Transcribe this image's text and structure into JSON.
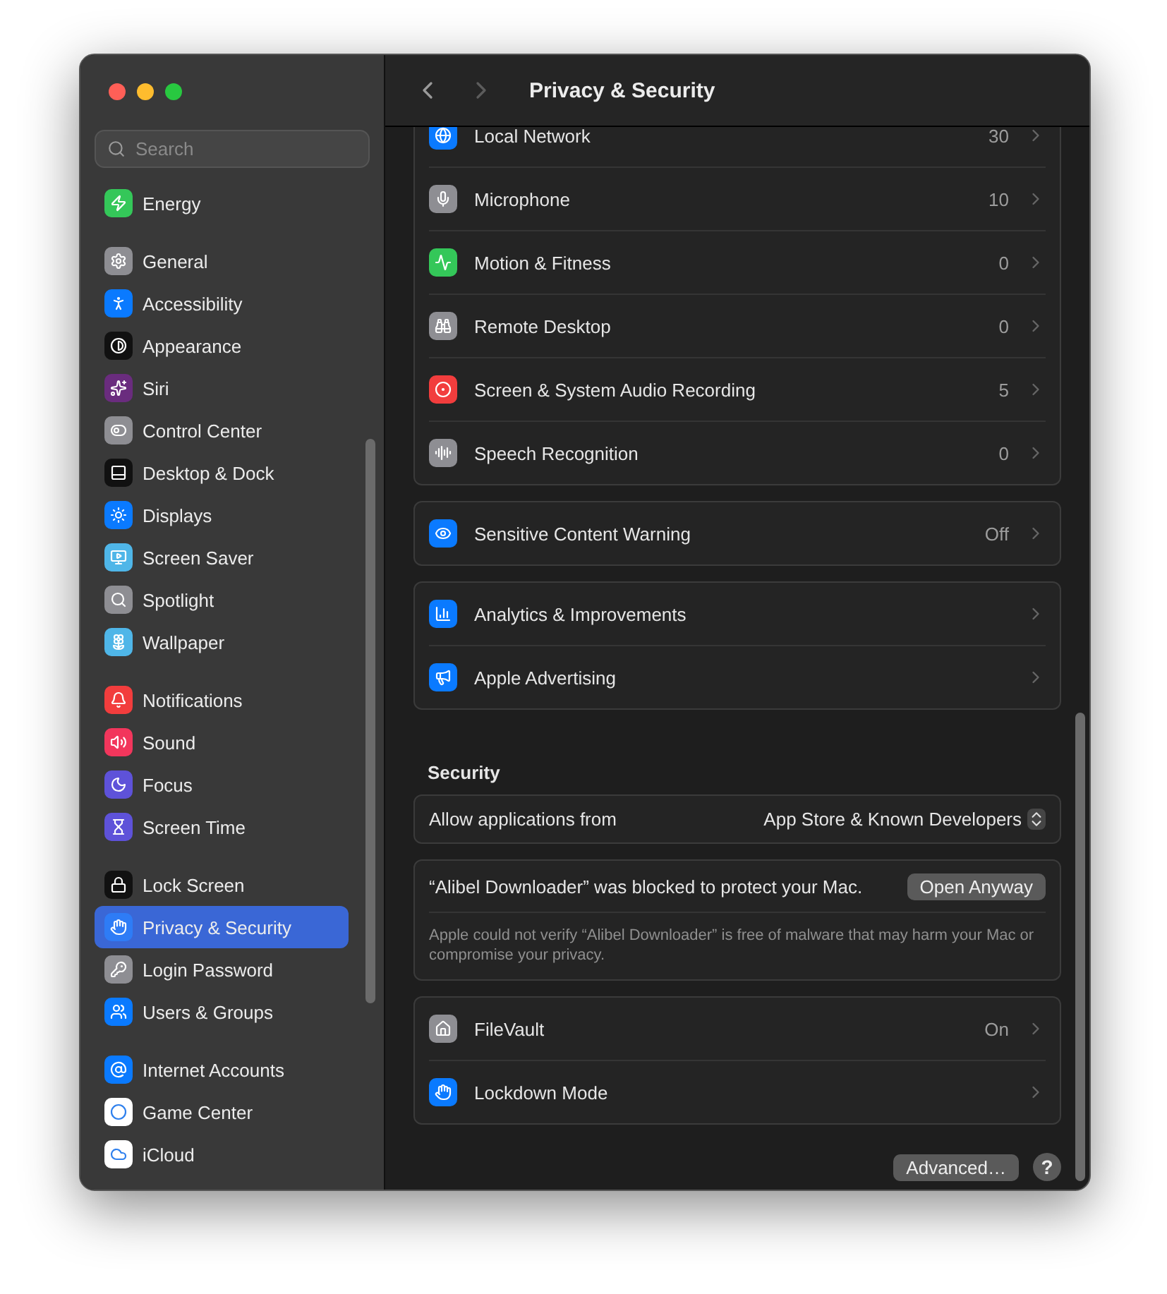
{
  "window": {
    "title": "Privacy & Security"
  },
  "sidebar": {
    "search": {
      "placeholder": "Search"
    },
    "groups": [
      {
        "items": [
          {
            "label": "Energy",
            "selected": false,
            "color": "#34c759"
          }
        ]
      },
      {
        "items": [
          {
            "label": "General",
            "selected": false,
            "color": "#8e8e93"
          },
          {
            "label": "Accessibility",
            "selected": false,
            "color": "#0a7aff"
          },
          {
            "label": "Appearance",
            "selected": false,
            "color": "#111111"
          },
          {
            "label": "Siri",
            "selected": false,
            "color": "#6a2c7e"
          },
          {
            "label": "Control Center",
            "selected": false,
            "color": "#8e8e93"
          },
          {
            "label": "Desktop & Dock",
            "selected": false,
            "color": "#111111"
          },
          {
            "label": "Displays",
            "selected": false,
            "color": "#0a7aff"
          },
          {
            "label": "Screen Saver",
            "selected": false,
            "color": "#4fb6e8"
          },
          {
            "label": "Spotlight",
            "selected": false,
            "color": "#8e8e93"
          },
          {
            "label": "Wallpaper",
            "selected": false,
            "color": "#4fb6e8"
          }
        ]
      },
      {
        "items": [
          {
            "label": "Notifications",
            "selected": false,
            "color": "#f23d3d"
          },
          {
            "label": "Sound",
            "selected": false,
            "color": "#f2365c"
          },
          {
            "label": "Focus",
            "selected": false,
            "color": "#5e52d9"
          },
          {
            "label": "Screen Time",
            "selected": false,
            "color": "#5e52d9"
          }
        ]
      },
      {
        "items": [
          {
            "label": "Lock Screen",
            "selected": false,
            "color": "#111111"
          },
          {
            "label": "Privacy & Security",
            "selected": true,
            "color": "#2e7cf6"
          },
          {
            "label": "Login Password",
            "selected": false,
            "color": "#8e8e93"
          },
          {
            "label": "Users & Groups",
            "selected": false,
            "color": "#0a7aff"
          }
        ]
      },
      {
        "items": [
          {
            "label": "Internet Accounts",
            "selected": false,
            "color": "#0a7aff"
          },
          {
            "label": "Game Center",
            "selected": false,
            "color": "#ffffff"
          },
          {
            "label": "iCloud",
            "selected": false,
            "color": "#ffffff"
          }
        ]
      }
    ]
  },
  "cards": [
    {
      "rows": [
        {
          "label": "Local Network",
          "value": "30",
          "color": "#0a7aff"
        },
        {
          "label": "Microphone",
          "value": "10",
          "color": "#8e8e93"
        },
        {
          "label": "Motion & Fitness",
          "value": "0",
          "color": "#34c759"
        },
        {
          "label": "Remote Desktop",
          "value": "0",
          "color": "#8e8e93"
        },
        {
          "label": "Screen & System Audio Recording",
          "value": "5",
          "color": "#f23d3d"
        },
        {
          "label": "Speech Recognition",
          "value": "0",
          "color": "#8e8e93"
        }
      ]
    },
    {
      "rows": [
        {
          "label": "Sensitive Content Warning",
          "value": "Off",
          "color": "#0a7aff"
        }
      ]
    },
    {
      "rows": [
        {
          "label": "Analytics & Improvements",
          "color": "#0a7aff"
        },
        {
          "label": "Apple Advertising",
          "color": "#0a7aff"
        }
      ]
    }
  ],
  "security": {
    "heading": "Security",
    "allow": {
      "label": "Allow applications from",
      "value": "App Store & Known Developers"
    },
    "blocked": {
      "message": "“Alibel Downloader” was blocked to protect your Mac.",
      "button": "Open Anyway",
      "detail": "Apple could not verify “Alibel Downloader” is free of malware that may harm your Mac or compromise your privacy."
    },
    "rows": [
      {
        "label": "FileVault",
        "value": "On",
        "color": "#8e8e93"
      },
      {
        "label": "Lockdown Mode",
        "color": "#0a7aff"
      }
    ]
  },
  "footer": {
    "advanced_button": "Advanced…",
    "help_button": "?"
  }
}
